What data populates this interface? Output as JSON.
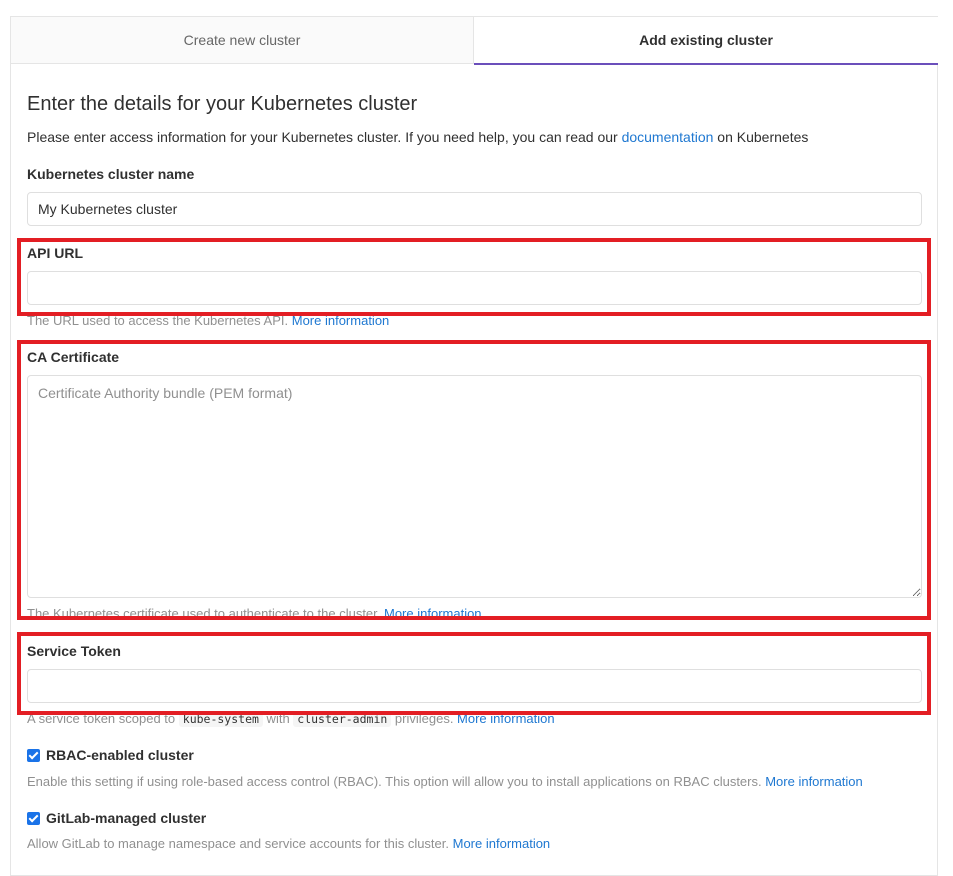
{
  "tabs": [
    {
      "label": "Create new cluster",
      "active": false
    },
    {
      "label": "Add existing cluster",
      "active": true
    }
  ],
  "form": {
    "title": "Enter the details for your Kubernetes cluster",
    "lead_text": "Please enter access information for your Kubernetes cluster. If you need help, you can read our ",
    "lead_link": "documentation",
    "lead_suffix": " on Kubernetes",
    "cluster_name": {
      "label": "Kubernetes cluster name",
      "value": "My Kubernetes cluster"
    },
    "api_url": {
      "label": "API URL",
      "value": "",
      "placeholder": "",
      "help": "The URL used to access the Kubernetes API. ",
      "help_link": "More information"
    },
    "ca_certificate": {
      "label": "CA Certificate",
      "value": "",
      "placeholder": "Certificate Authority bundle (PEM format)",
      "help": "The Kubernetes certificate used to authenticate to the cluster. ",
      "help_link": "More information"
    },
    "service_token": {
      "label": "Service Token",
      "value": "",
      "placeholder": "",
      "help_prefix": "A service token scoped to ",
      "code1": "kube-system",
      "help_mid": " with ",
      "code2": "cluster-admin",
      "help_suffix": " privileges. ",
      "help_link": "More information"
    },
    "rbac": {
      "label": "RBAC-enabled cluster",
      "checked": true,
      "help": "Enable this setting if using role-based access control (RBAC). This option will allow you to install applications on RBAC clusters. ",
      "help_link": "More information"
    },
    "gitlab_managed": {
      "label": "GitLab-managed cluster",
      "checked": true,
      "help": "Allow GitLab to manage namespace and service accounts for this cluster. ",
      "help_link": "More information"
    }
  },
  "colors": {
    "highlight": "#e31e24",
    "link": "#1f78d1",
    "active_tab_underline": "#6b4fbb",
    "checkbox": "#1a73e8"
  }
}
